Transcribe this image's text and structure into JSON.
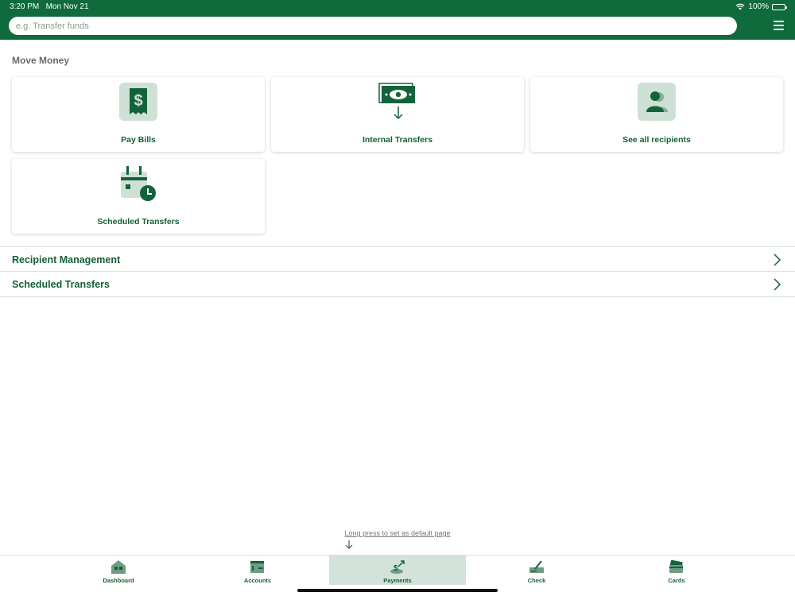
{
  "status_bar": {
    "time": "3:20 PM",
    "date": "Mon Nov 21",
    "battery": "100%"
  },
  "search": {
    "placeholder": "e.g. Transfer funds"
  },
  "move_money": {
    "title": "Move Money",
    "tiles": [
      {
        "label": "Pay Bills",
        "icon": "bill-receipt-icon"
      },
      {
        "label": "Internal Transfers",
        "icon": "cash-transfer-icon"
      },
      {
        "label": "See all recipients",
        "icon": "recipients-icon"
      },
      {
        "label": "Scheduled Transfers",
        "icon": "calendar-clock-icon"
      }
    ]
  },
  "list": [
    {
      "label": "Recipient Management"
    },
    {
      "label": "Scheduled Transfers"
    }
  ],
  "hint": "Long press to set as default page",
  "tabs": [
    {
      "label": "Dashboard",
      "icon": "dashboard-icon",
      "active": false
    },
    {
      "label": "Accounts",
      "icon": "accounts-icon",
      "active": false
    },
    {
      "label": "Payments",
      "icon": "payments-icon",
      "active": true
    },
    {
      "label": "Check",
      "icon": "check-deposit-icon",
      "active": false
    },
    {
      "label": "Cards",
      "icon": "cards-icon",
      "active": false
    }
  ],
  "colors": {
    "brand": "#0f6b3c",
    "accent_light": "#d3e2da",
    "text_green": "#155f35"
  }
}
